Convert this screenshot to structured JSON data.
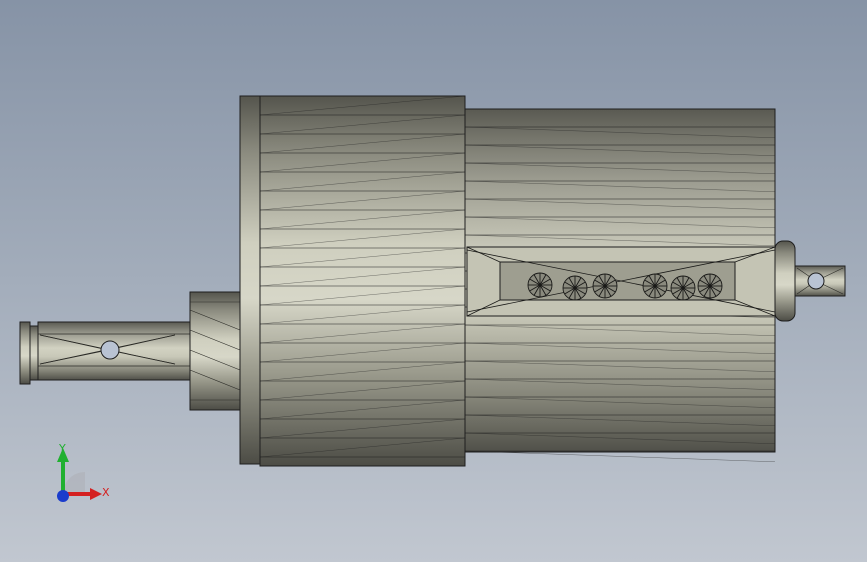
{
  "viewport": {
    "background_top": "#8693a6",
    "background_bottom": "#c1c7d0"
  },
  "model": {
    "description_icon": "shaded-mesh-shaft-assembly",
    "edge_color": "#1e1e1e",
    "face_light": "#d4d4c4",
    "face_dark": "#4a4a44"
  },
  "triad": {
    "x_label": "X",
    "y_label": "Y",
    "x_color": "#d42020",
    "y_color": "#20b030",
    "z_color": "#1a3ccc"
  }
}
